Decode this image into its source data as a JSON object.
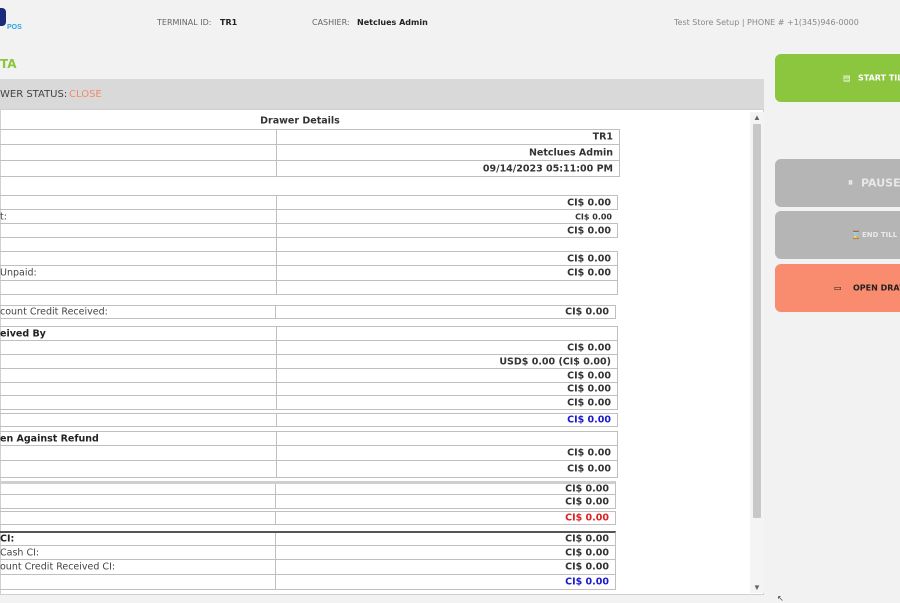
{
  "header": {
    "logo_text": "POS",
    "terminal_label": "TERMINAL ID:",
    "terminal_value": "TR1",
    "cashier_label": "CASHIER:",
    "cashier_value": "Netclues Admin",
    "store_info": "Test Store Setup | PHONE # +1(345)946-0000"
  },
  "section_title": "TA",
  "status": {
    "label": "WER STATUS:",
    "value": "CLOSE"
  },
  "table": {
    "title": "Drawer Details",
    "rows": [
      {
        "l": "",
        "r": "TR1"
      },
      {
        "l": "",
        "r": "Netclues Admin"
      },
      {
        "l": "",
        "r": "09/14/2023 05:11:00 PM"
      },
      {
        "l": "",
        "r": "CI$ 0.00"
      },
      {
        "l": "t:",
        "r": "CI$ 0.00"
      },
      {
        "l": "",
        "r": "CI$ 0.00"
      },
      {
        "l": "",
        "r": ""
      },
      {
        "l": "",
        "r": "CI$ 0.00"
      },
      {
        "l": "Unpaid:",
        "r": "CI$ 0.00"
      },
      {
        "l": "",
        "r": ""
      },
      {
        "l": "count Credit Received:",
        "r": "CI$ 0.00"
      },
      {
        "l": "eived By",
        "r": ""
      },
      {
        "l": "",
        "r": "CI$ 0.00"
      },
      {
        "l": "",
        "r": "USD$ 0.00 (CI$ 0.00)"
      },
      {
        "l": "",
        "r": "CI$ 0.00"
      },
      {
        "l": "",
        "r": "CI$ 0.00"
      },
      {
        "l": "",
        "r": "CI$ 0.00"
      },
      {
        "l": "",
        "r": "CI$ 0.00"
      },
      {
        "l": "en Against Refund",
        "r": ""
      },
      {
        "l": "",
        "r": "CI$ 0.00"
      },
      {
        "l": "",
        "r": "CI$ 0.00"
      },
      {
        "l": "",
        "r": "CI$ 0.00"
      },
      {
        "l": "",
        "r": "CI$ 0.00"
      },
      {
        "l": "",
        "r": "CI$ 0.00"
      },
      {
        "l": "CI:",
        "r": "CI$ 0.00"
      },
      {
        "l": "Cash CI:",
        "r": "CI$ 0.00"
      },
      {
        "l": "ount Credit Received CI:",
        "r": "CI$ 0.00"
      },
      {
        "l": "",
        "r": "CI$ 0.00"
      }
    ]
  },
  "buttons": {
    "start_till": "START TILL",
    "pause": "PAUSE",
    "end_till": "END TILL",
    "open_drawer": "OPEN DRAW"
  },
  "colors": {
    "accent_green": "#8cc63f",
    "status_close": "#f08a6c",
    "salmon": "#f98b6f",
    "blue_total": "#1a1ad0",
    "red_total": "#e02020"
  }
}
